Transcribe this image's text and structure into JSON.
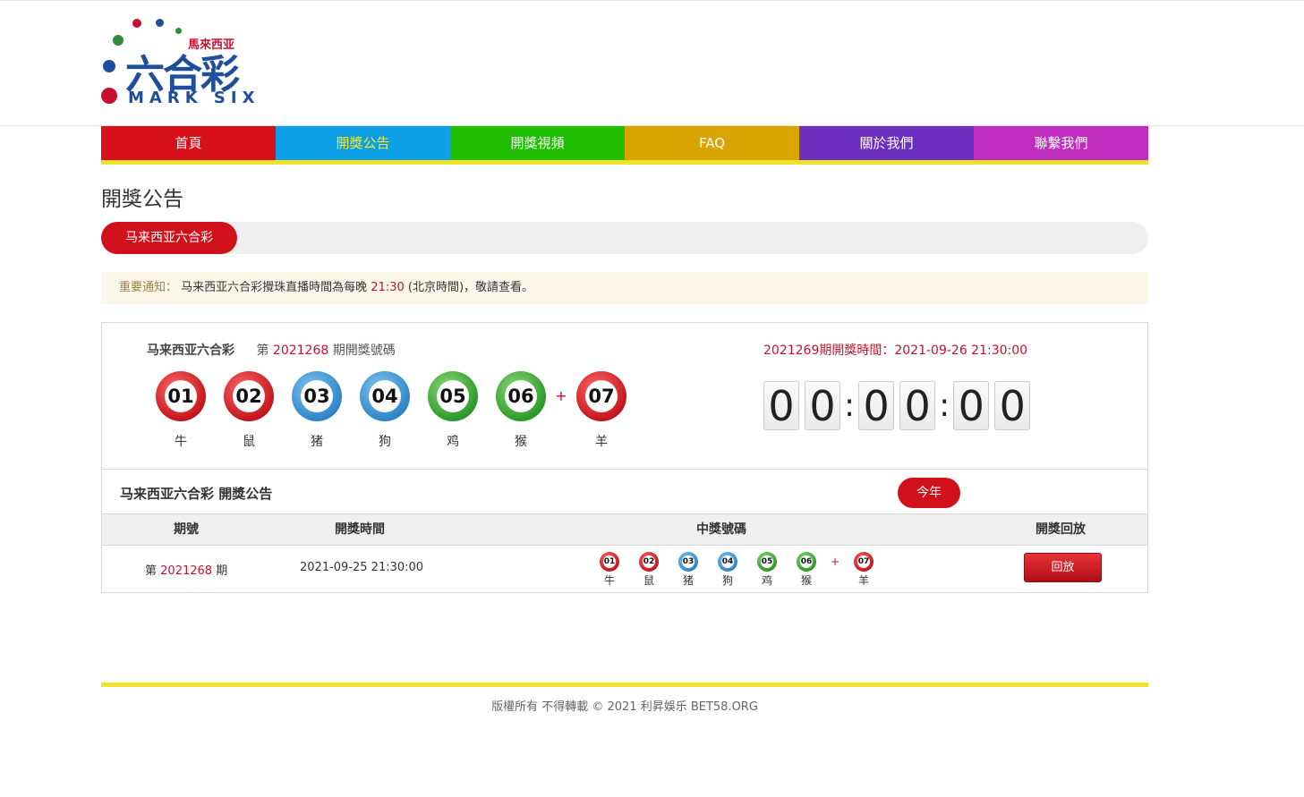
{
  "logo": {
    "cn": "六合彩",
    "en": "MARK SIX",
    "sub": "馬來西亚"
  },
  "nav": [
    {
      "label": "首頁",
      "color": "#d8101b",
      "text_color": "#ffffff"
    },
    {
      "label": "開獎公告",
      "color": "#0ea0e6",
      "text_color": "#f5ea30"
    },
    {
      "label": "開獎視頻",
      "color": "#1fbf00",
      "text_color": "#ffffff"
    },
    {
      "label": "FAQ",
      "color": "#d9a300",
      "text_color": "#ffffff"
    },
    {
      "label": "關於我們",
      "color": "#6c2fc0",
      "text_color": "#ffffff"
    },
    {
      "label": "聯繫我們",
      "color": "#c02cc0",
      "text_color": "#ffffff"
    }
  ],
  "page_title": "開獎公告",
  "tab": {
    "active": "马来西亚六合彩"
  },
  "notice": {
    "label": "重要通知：",
    "text_before": "马来西亚六合彩攪珠直播時間為每晚 ",
    "time": "21:30",
    "text_after": " (北京時間)，敬請查看。"
  },
  "latest": {
    "name": "马来西亚六合彩",
    "prefix": "第",
    "period": "2021268",
    "suffix": "期開獎號碼",
    "balls": [
      {
        "num": "01",
        "zodiac": "牛",
        "color": "r"
      },
      {
        "num": "02",
        "zodiac": "鼠",
        "color": "r"
      },
      {
        "num": "03",
        "zodiac": "猪",
        "color": "b"
      },
      {
        "num": "04",
        "zodiac": "狗",
        "color": "b"
      },
      {
        "num": "05",
        "zodiac": "鸡",
        "color": "g"
      },
      {
        "num": "06",
        "zodiac": "猴",
        "color": "g"
      }
    ],
    "plus": "+",
    "special": {
      "num": "07",
      "zodiac": "羊",
      "color": "r"
    }
  },
  "next": {
    "period": "2021269",
    "label": "期開獎時間：",
    "datetime": "2021-09-26 21:30:00"
  },
  "countdown": {
    "digits": [
      "0",
      "0",
      "0",
      "0",
      "0",
      "0"
    ]
  },
  "history": {
    "title": "马来西亚六合彩 開獎公告",
    "year_button": "今年",
    "columns": [
      "期號",
      "開獎時間",
      "中獎號碼",
      "開獎回放"
    ],
    "row": {
      "prefix": "第",
      "period": "2021268",
      "suffix": "期",
      "time": "2021-09-25 21:30:00",
      "replay": "回放"
    }
  },
  "footer": "版權所有 不得轉載 © 2021 利昇娛乐 BET58.ORG"
}
